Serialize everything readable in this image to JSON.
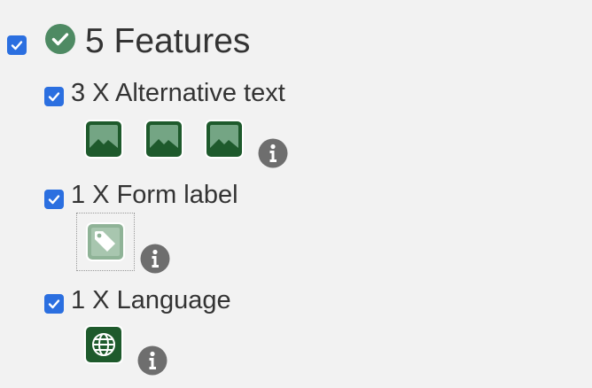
{
  "summary": {
    "title": "5 Features",
    "checked": true
  },
  "features": [
    {
      "label": "3 X Alternative text",
      "checked": true,
      "icon": "image-icon",
      "count": 3
    },
    {
      "label": "1 X Form label",
      "checked": true,
      "icon": "tag-icon",
      "count": 1
    },
    {
      "label": "1 X Language",
      "checked": true,
      "icon": "globe-icon",
      "count": 1
    }
  ],
  "colors": {
    "checkbox": "#2b6fe0",
    "success": "#4e8a63",
    "iconDark": "#1e5a2c",
    "iconFill": "#74a584",
    "info": "#6e6e6e"
  }
}
